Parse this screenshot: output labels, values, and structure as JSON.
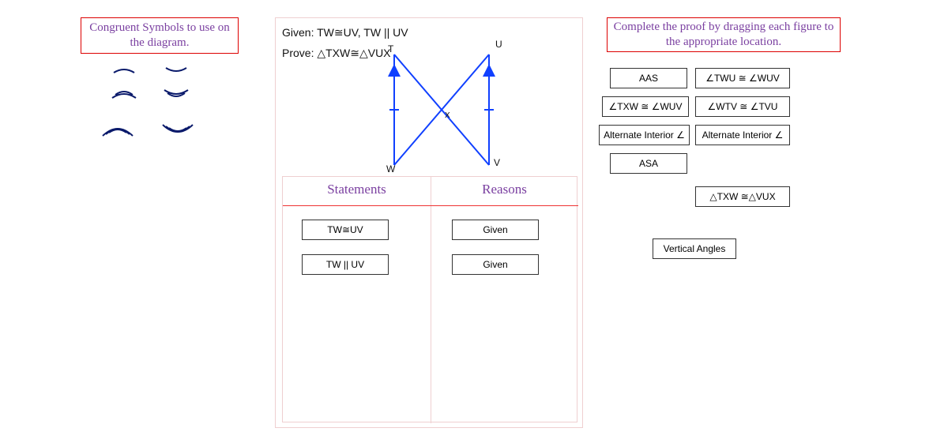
{
  "left": {
    "title": "Congruent Symbols to use on the diagram."
  },
  "given": {
    "label": "Given: ",
    "value": "TW≅UV, TW || UV"
  },
  "prove": {
    "label": "Prove: ",
    "value": "△TXW≅△VUX"
  },
  "diagram": {
    "T": "T",
    "U": "U",
    "V": "V",
    "W": "W",
    "X": "X"
  },
  "table": {
    "col1": "Statements",
    "col2": "Reasons",
    "rows": [
      {
        "s": "TW≅UV",
        "r": "Given"
      },
      {
        "s": "TW || UV",
        "r": "Given"
      }
    ]
  },
  "right": {
    "title": "Complete the proof by dragging each figure to the appropriate location.",
    "chips": {
      "aas": "AAS",
      "twu_wuv": "∠TWU ≅ ∠WUV",
      "txw_wuv": "∠TXW ≅ ∠WUV",
      "wtv_tvu": "∠WTV ≅ ∠TVU",
      "alt1": "Alternate Interior ∠",
      "alt2": "Alternate Interior ∠",
      "asa": "ASA",
      "tri": "△TXW ≅△VUX",
      "vert": "Vertical Angles"
    }
  }
}
